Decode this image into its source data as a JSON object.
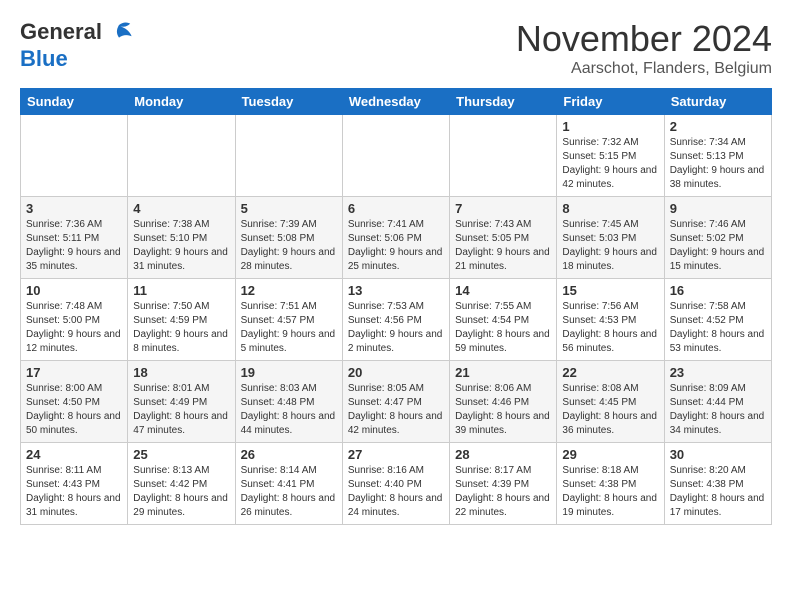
{
  "header": {
    "logo_general": "General",
    "logo_blue": "Blue",
    "month_title": "November 2024",
    "subtitle": "Aarschot, Flanders, Belgium"
  },
  "weekdays": [
    "Sunday",
    "Monday",
    "Tuesday",
    "Wednesday",
    "Thursday",
    "Friday",
    "Saturday"
  ],
  "weeks": [
    [
      {
        "day": "",
        "info": ""
      },
      {
        "day": "",
        "info": ""
      },
      {
        "day": "",
        "info": ""
      },
      {
        "day": "",
        "info": ""
      },
      {
        "day": "",
        "info": ""
      },
      {
        "day": "1",
        "info": "Sunrise: 7:32 AM\nSunset: 5:15 PM\nDaylight: 9 hours and 42 minutes."
      },
      {
        "day": "2",
        "info": "Sunrise: 7:34 AM\nSunset: 5:13 PM\nDaylight: 9 hours and 38 minutes."
      }
    ],
    [
      {
        "day": "3",
        "info": "Sunrise: 7:36 AM\nSunset: 5:11 PM\nDaylight: 9 hours and 35 minutes."
      },
      {
        "day": "4",
        "info": "Sunrise: 7:38 AM\nSunset: 5:10 PM\nDaylight: 9 hours and 31 minutes."
      },
      {
        "day": "5",
        "info": "Sunrise: 7:39 AM\nSunset: 5:08 PM\nDaylight: 9 hours and 28 minutes."
      },
      {
        "day": "6",
        "info": "Sunrise: 7:41 AM\nSunset: 5:06 PM\nDaylight: 9 hours and 25 minutes."
      },
      {
        "day": "7",
        "info": "Sunrise: 7:43 AM\nSunset: 5:05 PM\nDaylight: 9 hours and 21 minutes."
      },
      {
        "day": "8",
        "info": "Sunrise: 7:45 AM\nSunset: 5:03 PM\nDaylight: 9 hours and 18 minutes."
      },
      {
        "day": "9",
        "info": "Sunrise: 7:46 AM\nSunset: 5:02 PM\nDaylight: 9 hours and 15 minutes."
      }
    ],
    [
      {
        "day": "10",
        "info": "Sunrise: 7:48 AM\nSunset: 5:00 PM\nDaylight: 9 hours and 12 minutes."
      },
      {
        "day": "11",
        "info": "Sunrise: 7:50 AM\nSunset: 4:59 PM\nDaylight: 9 hours and 8 minutes."
      },
      {
        "day": "12",
        "info": "Sunrise: 7:51 AM\nSunset: 4:57 PM\nDaylight: 9 hours and 5 minutes."
      },
      {
        "day": "13",
        "info": "Sunrise: 7:53 AM\nSunset: 4:56 PM\nDaylight: 9 hours and 2 minutes."
      },
      {
        "day": "14",
        "info": "Sunrise: 7:55 AM\nSunset: 4:54 PM\nDaylight: 8 hours and 59 minutes."
      },
      {
        "day": "15",
        "info": "Sunrise: 7:56 AM\nSunset: 4:53 PM\nDaylight: 8 hours and 56 minutes."
      },
      {
        "day": "16",
        "info": "Sunrise: 7:58 AM\nSunset: 4:52 PM\nDaylight: 8 hours and 53 minutes."
      }
    ],
    [
      {
        "day": "17",
        "info": "Sunrise: 8:00 AM\nSunset: 4:50 PM\nDaylight: 8 hours and 50 minutes."
      },
      {
        "day": "18",
        "info": "Sunrise: 8:01 AM\nSunset: 4:49 PM\nDaylight: 8 hours and 47 minutes."
      },
      {
        "day": "19",
        "info": "Sunrise: 8:03 AM\nSunset: 4:48 PM\nDaylight: 8 hours and 44 minutes."
      },
      {
        "day": "20",
        "info": "Sunrise: 8:05 AM\nSunset: 4:47 PM\nDaylight: 8 hours and 42 minutes."
      },
      {
        "day": "21",
        "info": "Sunrise: 8:06 AM\nSunset: 4:46 PM\nDaylight: 8 hours and 39 minutes."
      },
      {
        "day": "22",
        "info": "Sunrise: 8:08 AM\nSunset: 4:45 PM\nDaylight: 8 hours and 36 minutes."
      },
      {
        "day": "23",
        "info": "Sunrise: 8:09 AM\nSunset: 4:44 PM\nDaylight: 8 hours and 34 minutes."
      }
    ],
    [
      {
        "day": "24",
        "info": "Sunrise: 8:11 AM\nSunset: 4:43 PM\nDaylight: 8 hours and 31 minutes."
      },
      {
        "day": "25",
        "info": "Sunrise: 8:13 AM\nSunset: 4:42 PM\nDaylight: 8 hours and 29 minutes."
      },
      {
        "day": "26",
        "info": "Sunrise: 8:14 AM\nSunset: 4:41 PM\nDaylight: 8 hours and 26 minutes."
      },
      {
        "day": "27",
        "info": "Sunrise: 8:16 AM\nSunset: 4:40 PM\nDaylight: 8 hours and 24 minutes."
      },
      {
        "day": "28",
        "info": "Sunrise: 8:17 AM\nSunset: 4:39 PM\nDaylight: 8 hours and 22 minutes."
      },
      {
        "day": "29",
        "info": "Sunrise: 8:18 AM\nSunset: 4:38 PM\nDaylight: 8 hours and 19 minutes."
      },
      {
        "day": "30",
        "info": "Sunrise: 8:20 AM\nSunset: 4:38 PM\nDaylight: 8 hours and 17 minutes."
      }
    ]
  ]
}
